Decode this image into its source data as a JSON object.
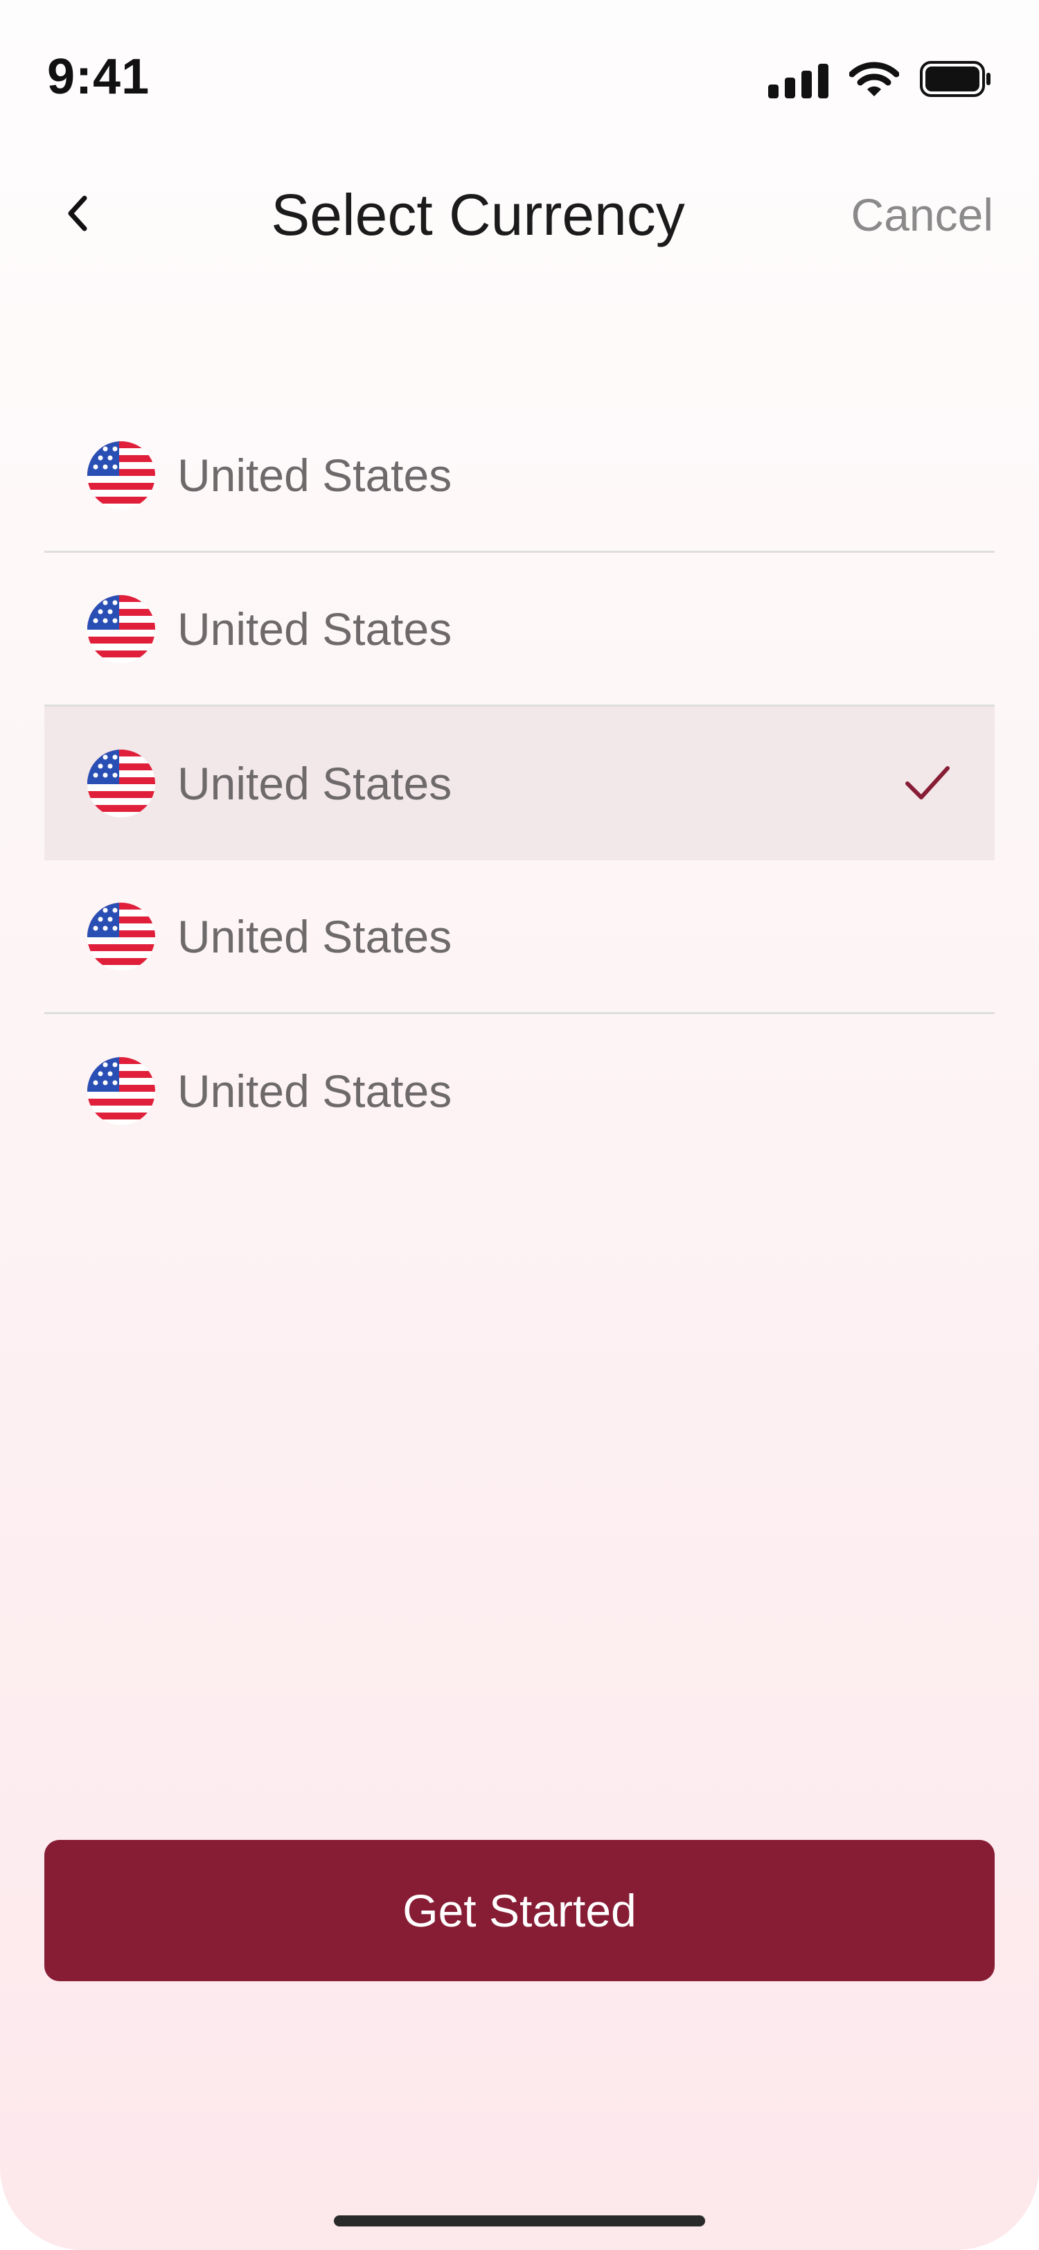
{
  "status_bar": {
    "time": "9:41",
    "icons": [
      "cellular-signal-icon",
      "wifi-icon",
      "battery-icon"
    ]
  },
  "nav": {
    "back_icon": "chevron-left-icon",
    "title": "Select Currency",
    "cancel_label": "Cancel"
  },
  "currencies": [
    {
      "label": "United States",
      "flag": "us-flag-icon",
      "selected": false
    },
    {
      "label": "United States",
      "flag": "us-flag-icon",
      "selected": false
    },
    {
      "label": "United States",
      "flag": "us-flag-icon",
      "selected": true
    },
    {
      "label": "United States",
      "flag": "us-flag-icon",
      "selected": false
    },
    {
      "label": "United States",
      "flag": "us-flag-icon",
      "selected": false
    }
  ],
  "selected_icon": "checkmark-icon",
  "primary_button": {
    "label": "Get Started"
  },
  "colors": {
    "accent": "#871d35",
    "selected_row_bg": "#f2e8ea",
    "row_text": "#6e6a6b",
    "cancel_text": "#8a8a8a",
    "flag_red": "#e0203a",
    "flag_blue": "#2a4fb4"
  }
}
